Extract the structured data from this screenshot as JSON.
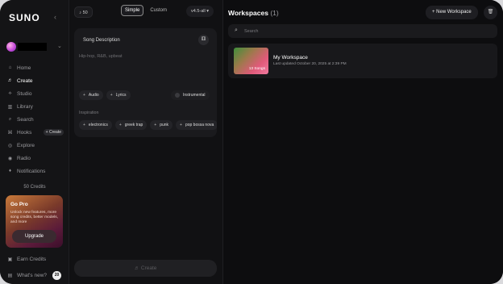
{
  "sidebar": {
    "logo": "SUNO",
    "collapse_icon": "‹",
    "user_chevron": "⌄",
    "nav": [
      {
        "label": "Home",
        "icon": "⌂",
        "active": false
      },
      {
        "label": "Create",
        "icon": "♬",
        "active": true
      },
      {
        "label": "Studio",
        "icon": "⟡",
        "active": false
      },
      {
        "label": "Library",
        "icon": "▥",
        "active": false
      },
      {
        "label": "Search",
        "icon": "⌕",
        "active": false
      },
      {
        "label": "Hooks",
        "icon": "⌘",
        "active": false
      },
      {
        "label": "Explore",
        "icon": "◎",
        "active": false
      },
      {
        "label": "Radio",
        "icon": "◉",
        "active": false
      },
      {
        "label": "Notifications",
        "icon": "♦",
        "active": false
      }
    ],
    "hooks_create_label": "+ Create",
    "credits": "50 Credits",
    "gopro": {
      "title": "Go Pro",
      "text": "Unlock new features, more song credits, better models, and more",
      "button": "Upgrade"
    },
    "earn_credits": "Earn Credits",
    "whats_new": "What's new?",
    "whats_new_badge": "20"
  },
  "create": {
    "credit_chip": "♪ 50",
    "modes": [
      "Simple",
      "Custom"
    ],
    "active_mode": "Simple",
    "model_version": "v4.5-all ▾",
    "description_title": "Song Description",
    "dice_icon": "⚅",
    "description_placeholder": "Hip-hop, R&B, upbeat",
    "options": [
      "Audio",
      "Lyrics"
    ],
    "instrumental": "Instrumental",
    "inspiration_label": "Inspiration",
    "inspiration": [
      "electronics",
      "greek trap",
      "punk",
      "pop bossa nova"
    ],
    "create_button": "♬ Create"
  },
  "workspaces": {
    "title": "Workspaces",
    "count": "(1)",
    "new_button": "+ New Workspace",
    "trash_icon": "🗑",
    "search_placeholder": "Search",
    "items": [
      {
        "name": "My Workspace",
        "updated": "Last updated October 20, 2025 at 2:39 PM",
        "songs": "13 Songs"
      }
    ]
  },
  "colors": {
    "background": "#0b0b0c",
    "sidebar": "#141416",
    "card": "#1a1a1d",
    "accent_pink": "#e05a7a"
  }
}
